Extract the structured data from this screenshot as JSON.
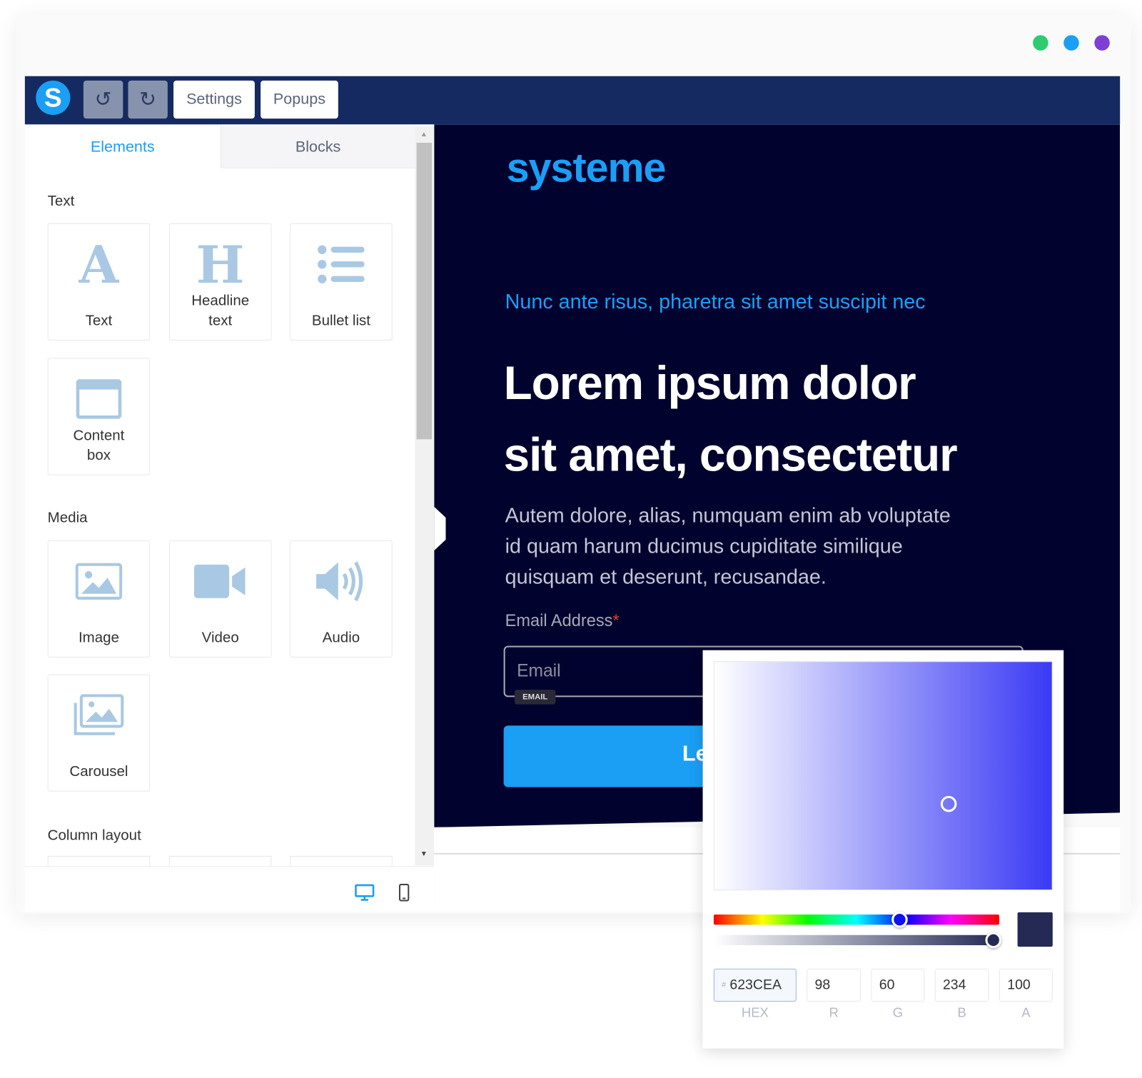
{
  "window_dots": {
    "colors": [
      "#2ecc71",
      "#1a9ff5",
      "#7e3fd6"
    ]
  },
  "toolbar": {
    "logo": "S",
    "undo_icon": "↺",
    "redo_icon": "↻",
    "settings_label": "Settings",
    "popups_label": "Popups",
    "bg": "#152a60"
  },
  "sidebar": {
    "tabs": [
      {
        "label": "Elements",
        "active": true
      },
      {
        "label": "Blocks",
        "active": false
      }
    ],
    "sections": [
      {
        "title": "Text",
        "items": [
          {
            "label": "Text",
            "icon": "text-a-icon"
          },
          {
            "label": "Headline text",
            "icon": "headline-h-icon"
          },
          {
            "label": "Bullet list",
            "icon": "bullet-list-icon"
          },
          {
            "label": "Content box",
            "icon": "content-box-icon"
          }
        ]
      },
      {
        "title": "Media",
        "items": [
          {
            "label": "Image",
            "icon": "image-icon"
          },
          {
            "label": "Video",
            "icon": "video-icon"
          },
          {
            "label": "Audio",
            "icon": "audio-icon"
          },
          {
            "label": "Carousel",
            "icon": "carousel-icon"
          }
        ]
      },
      {
        "title": "Column layout",
        "items": []
      }
    ]
  },
  "canvas": {
    "brand": "systeme",
    "subtitle": "Nunc ante risus, pharetra sit amet suscipit nec",
    "headline_1": "Lorem ipsum dolor",
    "headline_2": "sit amet, consectetur",
    "paragraph_1": "Autem dolore, alias, numquam enim ab voluptate",
    "paragraph_2": "id quam harum ducimus cupiditate similique",
    "paragraph_3": "quisquam et deserunt, recusandae.",
    "email_label": "Email Address",
    "required_mark": "*",
    "email_placeholder": "Email",
    "email_badge": "EMAIL",
    "button_text": "Le",
    "accent": "#1a9ff5",
    "bg": "#02022e"
  },
  "color_picker": {
    "hex": "623CEA",
    "hash": "#",
    "r": "98",
    "g": "60",
    "b": "234",
    "a": "100",
    "labels": {
      "hex": "HEX",
      "r": "R",
      "g": "G",
      "b": "B",
      "a": "A"
    },
    "swatch": "#252a55",
    "hue_position": 0.65,
    "alpha_position": 0.98
  }
}
